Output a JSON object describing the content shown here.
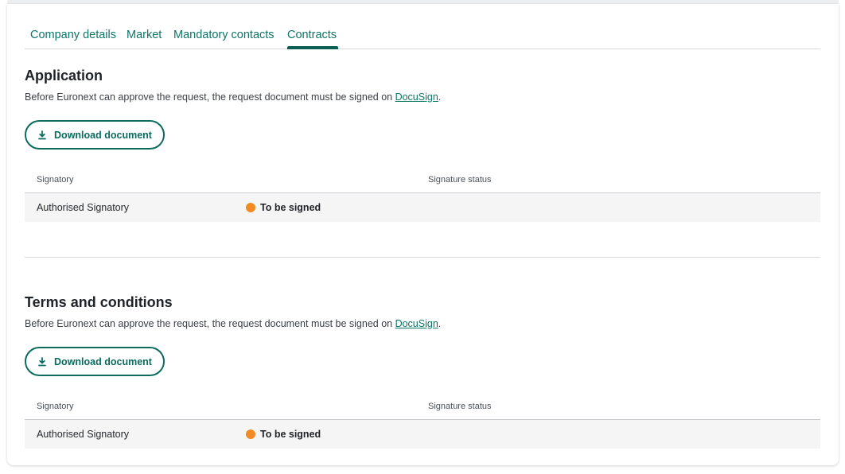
{
  "tabs": [
    {
      "label": "Company details"
    },
    {
      "label": "Market"
    },
    {
      "label": "Mandatory contacts"
    },
    {
      "label": "Contracts",
      "active": true
    }
  ],
  "sections": [
    {
      "title": "Application",
      "description_prefix": "Before Euronext can approve the request, the request document must be signed on ",
      "link_text": "DocuSign",
      "description_suffix": ".",
      "download_label": "Download document",
      "table": {
        "headers": [
          "Signatory",
          "Signature status"
        ],
        "rows": [
          {
            "signatory": "Authorised Signatory",
            "status": "To be signed"
          }
        ]
      }
    },
    {
      "title": "Terms and conditions",
      "description_prefix": "Before Euronext can approve the request, the request document must be signed on ",
      "link_text": "DocuSign",
      "description_suffix": ".",
      "download_label": "Download document",
      "table": {
        "headers": [
          "Signatory",
          "Signature status"
        ],
        "rows": [
          {
            "signatory": "Authorised Signatory",
            "status": "To be signed"
          }
        ]
      }
    }
  ],
  "colors": {
    "accent": "#0c7566",
    "status_pending": "#f28a23"
  },
  "icons": {
    "download": "download-icon",
    "status": "status-dot"
  }
}
